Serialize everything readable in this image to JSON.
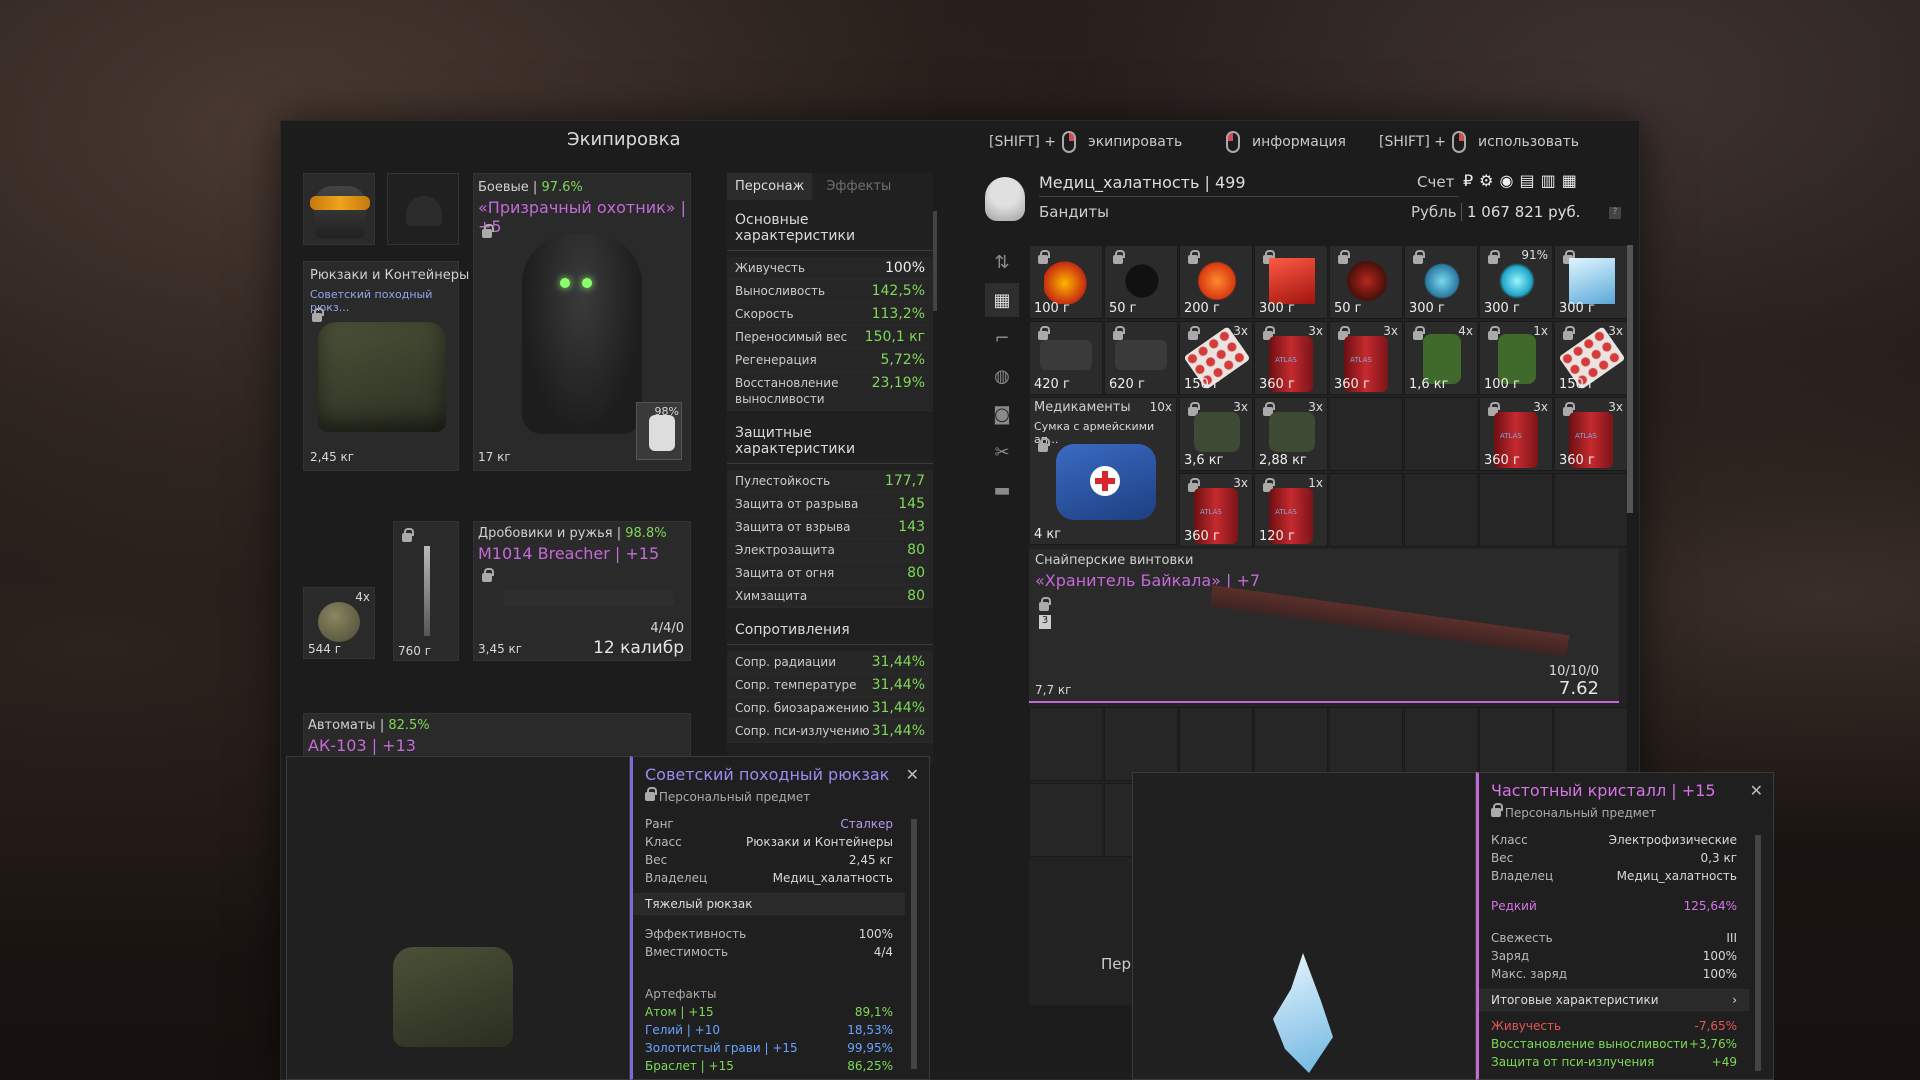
{
  "header": {
    "title": "Экипировка",
    "hint1_key": "[SHIFT] +",
    "hint1_action": "экипировать",
    "hint2_action": "информация",
    "hint3_key": "[SHIFT] +",
    "hint3_action": "использовать"
  },
  "equipment": {
    "backpack_category": "Рюкзаки и Контейнеры",
    "backpack_name": "Советский походный рюкз...",
    "backpack_weight": "2,45 кг",
    "armor_category": "Боевые",
    "armor_pct": "97.6%",
    "armor_name": "«Призрачный охотник» | +5",
    "armor_weight": "17 кг",
    "armor_slot_pct": "98%",
    "small_weight": "544 г",
    "small_count": "4x",
    "knife_weight": "760 г",
    "shotgun_category": "Дробовики и ружья",
    "shotgun_pct": "98.8%",
    "shotgun_name": "M1014 Breacher | +15",
    "shotgun_weight": "3,45 кг",
    "shotgun_ammo": "4/4/0",
    "shotgun_caliber": "12 калибр",
    "rifle_category": "Автоматы",
    "rifle_pct": "82.5%",
    "rifle_name": "АК-103 | +13"
  },
  "stats": {
    "tab_character": "Персонаж",
    "tab_effects": "Эффекты",
    "basic_title": "Основные характеристики",
    "basic": [
      {
        "k": "Живучесть",
        "v": "100%"
      },
      {
        "k": "Выносливость",
        "v": "142,5%"
      },
      {
        "k": "Скорость",
        "v": "113,2%"
      },
      {
        "k": "Переносимый вес",
        "v": "150,1 кг"
      },
      {
        "k": "Регенерация",
        "v": "5,72%"
      },
      {
        "k": "Восстановление выносливости",
        "v": "23,19%"
      }
    ],
    "prot_title": "Защитные характеристики",
    "prot": [
      {
        "k": "Пулестойкость",
        "v": "177,7"
      },
      {
        "k": "Защита от разрыва",
        "v": "145"
      },
      {
        "k": "Защита от взрыва",
        "v": "143"
      },
      {
        "k": "Электрозащита",
        "v": "80"
      },
      {
        "k": "Защита от огня",
        "v": "80"
      },
      {
        "k": "Химзащита",
        "v": "80"
      }
    ],
    "res_title": "Сопротивления",
    "res": [
      {
        "k": "Сопр. радиации",
        "v": "31,44%"
      },
      {
        "k": "Сопр. температуре",
        "v": "31,44%"
      },
      {
        "k": "Сопр. биозаражению",
        "v": "31,44%"
      },
      {
        "k": "Сопр. пси-излучению",
        "v": "31,44%"
      }
    ]
  },
  "player": {
    "name": "Медиц_халатность | 499",
    "faction": "Бандиты",
    "account_label": "Счет",
    "currency_label": "Рубль",
    "money": "1 067 821 руб."
  },
  "inventory": {
    "row1": [
      {
        "w": "100 г"
      },
      {
        "w": "50 г"
      },
      {
        "w": "200 г"
      },
      {
        "w": "300 г"
      },
      {
        "w": "50 г"
      },
      {
        "w": "300 г"
      },
      {
        "w": "300 г",
        "c": "91%"
      },
      {
        "w": "300 г"
      }
    ],
    "row2": [
      {
        "w": "420 г"
      },
      {
        "w": "620 г"
      },
      {
        "w": "150 г",
        "c": "3x"
      },
      {
        "w": "360 г",
        "c": "3x"
      },
      {
        "w": "360 г",
        "c": "3x"
      },
      {
        "w": "1,6 кг",
        "c": "4x"
      },
      {
        "w": "100 г",
        "c": "1x"
      },
      {
        "w": "150 г",
        "c": "3x"
      }
    ],
    "med_category": "Медикаменты",
    "med_count": "10x",
    "med_name": "Сумка с армейскими ап...",
    "med_weight": "4 кг",
    "row3": [
      {
        "w": "3,6 кг",
        "c": "3x"
      },
      {
        "w": "2,88 кг",
        "c": "3x"
      }
    ],
    "row3r": [
      {
        "w": "360 г",
        "c": "3x"
      },
      {
        "w": "360 г",
        "c": "3x"
      }
    ],
    "row4": [
      {
        "w": "360 г",
        "c": "3x"
      },
      {
        "w": "120 г",
        "c": "1x"
      }
    ],
    "sniper_category": "Снайперские винтовки",
    "sniper_name": "«Хранитель Байкала» | +7",
    "sniper_weight": "7,7 кг",
    "sniper_ammo": "10/10/0",
    "sniper_caliber": "7.62",
    "footer": "Пер"
  },
  "tip1": {
    "title": "Советский походный рюкзак",
    "sub": "Персональный предмет",
    "rows": [
      {
        "k": "Ранг",
        "v": "Сталкер"
      },
      {
        "k": "Класс",
        "v": "Рюкзаки и Контейнеры"
      },
      {
        "k": "Вес",
        "v": "2,45 кг"
      },
      {
        "k": "Владелец",
        "v": "Медиц_халатность"
      }
    ],
    "type": "Тяжелый рюкзак",
    "rows2": [
      {
        "k": "Эффективность",
        "v": "100%"
      },
      {
        "k": "Вместимость",
        "v": "4/4"
      }
    ],
    "art_title": "Артефакты",
    "arts": [
      {
        "k": "Атом | +15",
        "v": "89,1%"
      },
      {
        "k": "Гелий | +10",
        "v": "18,53%"
      },
      {
        "k": "Золотистый грави | +15",
        "v": "99,95%"
      },
      {
        "k": "Браслет | +15",
        "v": "86,25%"
      }
    ]
  },
  "tip2": {
    "title": "Частотный кристалл | +15",
    "sub": "Персональный предмет",
    "rows": [
      {
        "k": "Класс",
        "v": "Электрофизические"
      },
      {
        "k": "Вес",
        "v": "0,3 кг"
      },
      {
        "k": "Владелец",
        "v": "Медиц_халатность"
      }
    ],
    "rarity_k": "Редкий",
    "rarity_v": "125,64%",
    "rows2": [
      {
        "k": "Свежесть",
        "v": "III"
      },
      {
        "k": "Заряд",
        "v": "100%"
      },
      {
        "k": "Макс. заряд",
        "v": "100%"
      }
    ],
    "total": "Итоговые характеристики",
    "eff": [
      {
        "k": "Живучесть",
        "v": "-7,65%"
      },
      {
        "k": "Восстановление выносливости",
        "v": "+3,76%"
      },
      {
        "k": "Защита от пси-излучения",
        "v": "+49"
      }
    ]
  }
}
